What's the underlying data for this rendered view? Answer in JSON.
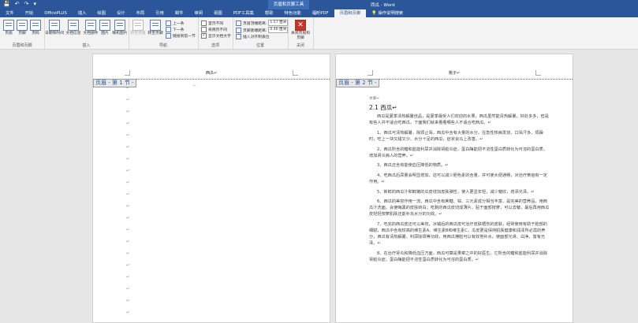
{
  "window": {
    "title": "西瓜 - Word",
    "context_tab_title": "页眉和页脚工具",
    "quick_access": [
      "💾",
      "↶",
      "↷",
      "▾"
    ]
  },
  "tabs": [
    "文件",
    "开始",
    "OfficePLUS",
    "插入",
    "绘图",
    "设计",
    "布局",
    "引用",
    "邮件",
    "审阅",
    "视图",
    "PDF工具集",
    "帮助",
    "特色功能",
    "福昕PDF",
    "页眉和页脚",
    "操作说明搜索"
  ],
  "active_tab_index": 15,
  "ribbon": {
    "groups": {
      "header_footer": "页眉和页脚",
      "insert": "插入",
      "navigation": "导航",
      "options": "选项",
      "position": "位置",
      "close": "关闭"
    },
    "buttons": {
      "header": "页眉",
      "footer": "页脚",
      "page_number": "页码",
      "date_time": "日期和时间",
      "doc_info": "文档信息",
      "doc_parts": "文档部件",
      "pictures": "图片",
      "online_pictures": "联机图片",
      "goto_header": "转至页眉",
      "goto_footer": "转至页脚",
      "previous": "上一条",
      "next": "下一条",
      "link_previous": "链接到前一节",
      "close_header_footer": "关闭页眉和页脚"
    },
    "options": {
      "diff_first": "首页不同",
      "diff_odd_even": "奇偶页不同",
      "show_doc_text": "显示文档文字"
    },
    "position": {
      "header_top_label": "页眉顶端距离:",
      "header_top_value": "1.57 厘米",
      "footer_bottom_label": "页脚底端距离:",
      "footer_bottom_value": "0.46 厘米",
      "insert_align_tab": "插入对齐制表位"
    }
  },
  "pages": {
    "left": {
      "header_text": "西瓜↵",
      "section_tag": "页眉 - 第 1 节 -",
      "para_mark": "↵"
    },
    "right": {
      "header_text": "桃子↵",
      "section_tag": "页眉 - 第 2 节 -",
      "lines": [
        {
          "style": "small",
          "text": "水果↵"
        },
        {
          "style": "heading",
          "text": "2.1  西瓜↵"
        },
        {
          "style": "ind",
          "text": "西瓜是夏季清热解暑佳品，是夏季最受人们欢迎的水果，西瓜虽然能清热解暑，好处多多，但是有些人并不适合吃西瓜，下面我们就来看看哪些人不适合吃西瓜。↵"
        },
        {
          "style": "ind",
          "text": "1、西瓜可清热解暑，除烦止渴，西瓜中含有大量的水分，在急性热病发烧、口渴汗多、烦躁时，吃上一块又甜又沙、水分十足的西瓜，症状会马上改善。↵"
        },
        {
          "style": "ind",
          "text": "2、西瓜所含的糖和盐能利尿并消除肾脏炎症，蛋白酶能把不溶性蛋白质转化为可溶的蛋白质，增加肾炎病人的营养。↵"
        },
        {
          "style": "ind",
          "text": "3、西瓜还含有能使血压降低的物质。↵"
        },
        {
          "style": "ind",
          "text": "4、吃西瓜后尿量会明显增加，这可以减少胆色素的含量，并可使大便通畅，对治疗黄疸有一定作用。↵"
        },
        {
          "style": "ind",
          "text": "5、新鲜的西瓜汁和鲜嫩的瓜皮增加皮肤弹性，使人更显年轻，减少皱纹，增添光泽。↵"
        },
        {
          "style": "ind",
          "text": "6、西瓜的美容作用一流，西瓜中含有蔗糖、锌、三元素成分相当丰富，是完美的营养品，用西瓜汁洗面，会使晦黑的皮肤转白；吃剩的西瓜皮切成薄片，贴于面部按摩，可以去皱，最后再用西瓜皮轻轻按摩肌肤还能补充水分的功效。↵"
        },
        {
          "style": "ind",
          "text": "7、吃完的西瓜皮还可以美容，冰镇后的西瓜皮可治疗皮肤晒伤的皮肤，经常使用有助于脸部的细腻，西瓜中含有较高的维生素A、维生素B和维生素C，瓜皮更是保持肌肤健康和润泽所必需的养分，西瓜有清热解暑、利尿除烦等功效，用西瓜擦脸可以有效地补水，使面部光滑、白净、富有光泽。↵"
        },
        {
          "style": "ind",
          "text": "8、在治疗肾炎和降低血压方面，西瓜可算是果菜之中的好医生。它所含的糖和盐能利尿并消除肾脏炎症，蛋白酶能把不溶性蛋白质转化为可溶的蛋白质。↵"
        }
      ]
    }
  }
}
